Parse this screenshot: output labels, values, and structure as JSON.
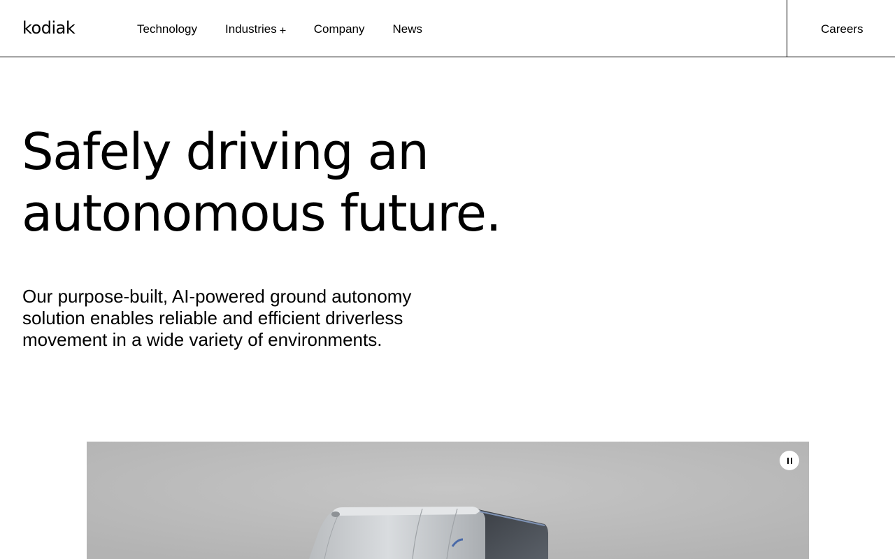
{
  "header": {
    "logo_text": "kodiak",
    "nav": [
      {
        "label": "Technology",
        "has_submenu": false
      },
      {
        "label": "Industries",
        "has_submenu": true,
        "submenu_icon": "plus-icon"
      },
      {
        "label": "Company",
        "has_submenu": false
      },
      {
        "label": "News",
        "has_submenu": false
      }
    ],
    "careers_label": "Careers"
  },
  "hero": {
    "title_line1": "Safely driving an",
    "title_line2": "autonomous future.",
    "subtitle_line1": "Our purpose-built, AI-powered ground autonomy",
    "subtitle_line2": "solution enables reliable and efficient driverless",
    "subtitle_line3": "movement in a wide variety of environments."
  },
  "media": {
    "control_icon": "pause-icon",
    "background_color": "#bebebe"
  },
  "colors": {
    "text": "#000000",
    "background": "#ffffff",
    "divider": "#000000"
  }
}
